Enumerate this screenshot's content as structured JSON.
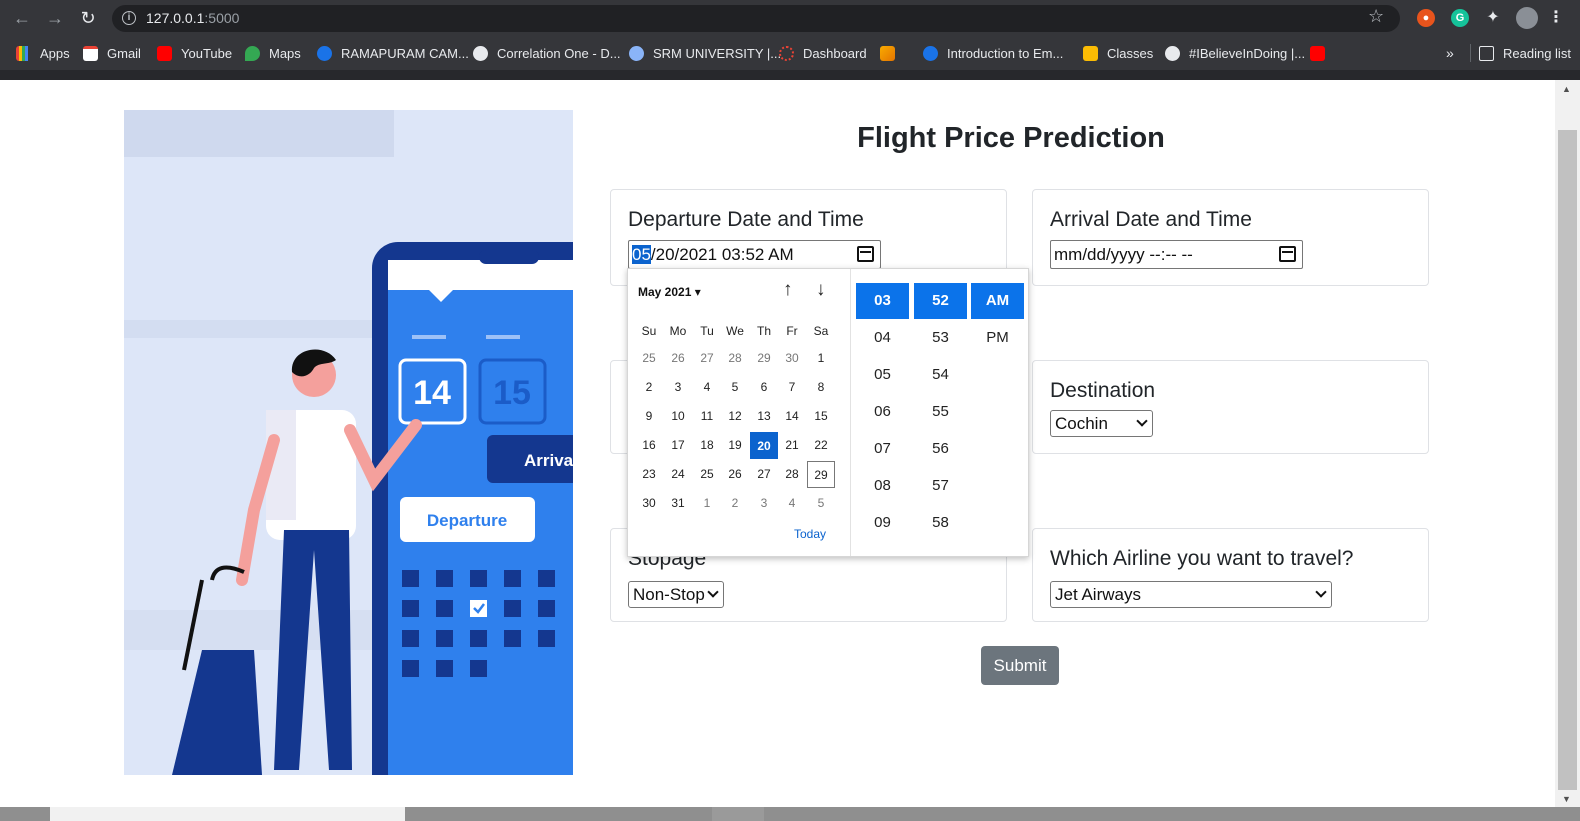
{
  "browser": {
    "url_host": "127.0.0.1",
    "url_port": ":5000",
    "bookmarks": [
      "Apps",
      "Gmail",
      "YouTube",
      "Maps",
      "RAMAPURAM CAM...",
      "Correlation One - D...",
      "SRM UNIVERSITY |...",
      "Dashboard",
      "Introduction to Em...",
      "Classes",
      "#IBelieveInDoing |..."
    ],
    "reading_list": "Reading list",
    "overflow": "»"
  },
  "page": {
    "title": "Flight Price Prediction",
    "illustration": {
      "date1": "14",
      "date2": "15",
      "departure": "Departure",
      "arrival": "Arriva"
    },
    "departure": {
      "label": "Departure Date and Time",
      "value_highlight": "05",
      "value_rest": "/20/2021 03:52  AM"
    },
    "arrival": {
      "label": "Arrival Date and Time",
      "placeholder": "mm/dd/yyyy --:-- --"
    },
    "destination": {
      "label": "Destination",
      "value": "Cochin"
    },
    "stopage": {
      "label": "Stopage",
      "value": "Non-Stop"
    },
    "airline": {
      "label": "Which Airline you want to travel?",
      "value": "Jet Airways"
    },
    "submit": "Submit"
  },
  "picker": {
    "month": "May 2021",
    "weekdays": [
      "Su",
      "Mo",
      "Tu",
      "We",
      "Th",
      "Fr",
      "Sa"
    ],
    "days": [
      [
        "25",
        "26",
        "27",
        "28",
        "29",
        "30",
        "1"
      ],
      [
        "2",
        "3",
        "4",
        "5",
        "6",
        "7",
        "8"
      ],
      [
        "9",
        "10",
        "11",
        "12",
        "13",
        "14",
        "15"
      ],
      [
        "16",
        "17",
        "18",
        "19",
        "20",
        "21",
        "22"
      ],
      [
        "23",
        "24",
        "25",
        "26",
        "27",
        "28",
        "29"
      ],
      [
        "30",
        "31",
        "1",
        "2",
        "3",
        "4",
        "5"
      ]
    ],
    "selected_day": "20",
    "today_day": "29",
    "today_label": "Today",
    "hours": [
      "03",
      "04",
      "05",
      "06",
      "07",
      "08",
      "09"
    ],
    "minutes": [
      "52",
      "53",
      "54",
      "55",
      "56",
      "57",
      "58"
    ],
    "ampm": [
      "AM",
      "PM"
    ],
    "selected_hour": "03",
    "selected_minute": "52",
    "selected_ampm": "AM"
  },
  "colors": {
    "accent": "#0b63ce",
    "submit": "#6c757d",
    "chrome": "#35363a"
  }
}
